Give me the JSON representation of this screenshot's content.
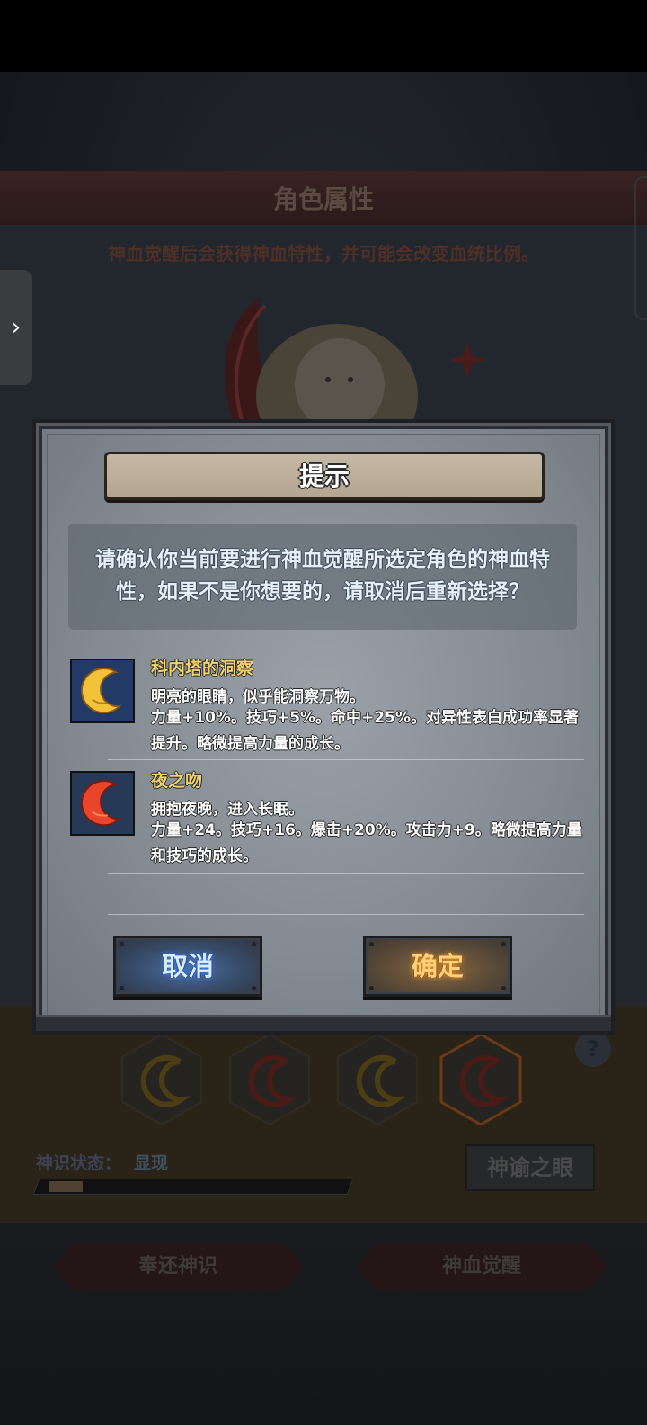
{
  "background": {
    "title": "角色属性",
    "subtitle": "神血觉醒后会获得神血特性，并可能会改变血统比例。",
    "status_label": "神识状态：",
    "status_value": "显现",
    "eye_button": "神谕之眼",
    "help_symbol": "?",
    "bottom_left_button": "奉还神识",
    "bottom_right_button": "神血觉醒",
    "side_arrow": "›"
  },
  "dialog": {
    "title": "提示",
    "message": "请确认你当前要进行神血觉醒所选定角色的神血特性，如果不是你想要的，请取消后重新选择？",
    "traits": [
      {
        "name": "科内塔的洞察",
        "desc": "明亮的眼睛，似乎能洞察万物。",
        "effect": "力量+10%。技巧+5%。命中+25%。对异性表白成功率显著提升。略微提高力量的成长。",
        "icon": "golden-crescent-moon-icon",
        "icon_color": "#f2c23a",
        "icon_bg": "#233a66"
      },
      {
        "name": "夜之吻",
        "desc": "拥抱夜晚，进入长眠。",
        "effect": "力量+24。技巧+16。爆击+20%。攻击力+9。略微提高力量和技巧的成长。",
        "icon": "red-crescent-moon-icon",
        "icon_color": "#e8452a",
        "icon_bg": "#263a58"
      }
    ],
    "cancel_label": "取消",
    "confirm_label": "确定"
  },
  "colors": {
    "trait_name": "#f2d36a",
    "cancel_glow": "#3d7dff",
    "confirm_glow": "#ff9a2a"
  }
}
